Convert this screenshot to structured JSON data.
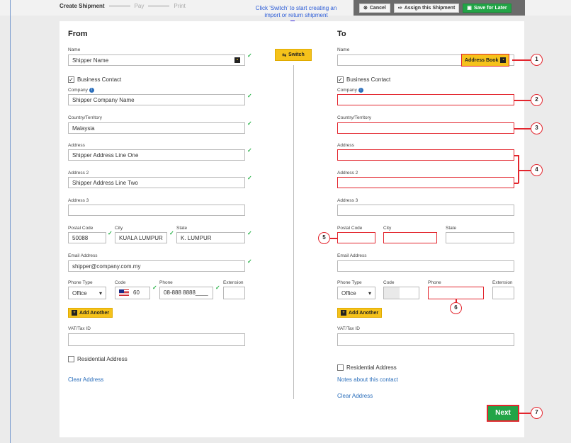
{
  "steps": {
    "create": "Create Shipment",
    "pay": "Pay",
    "print": "Print"
  },
  "hint": "Click 'Switch' to start creating an import or return shipment",
  "actions": {
    "cancel": "Cancel",
    "assign": "Assign this Shipment",
    "save": "Save for Later"
  },
  "switch_label": "Switch",
  "from": {
    "heading": "From",
    "name_label": "Name",
    "name_value": "Shipper Name",
    "business_contact": "Business Contact",
    "company_label": "Company",
    "company_value": "Shipper Company Name",
    "country_label": "Country/Territory",
    "country_value": "Malaysia",
    "address_label": "Address",
    "address_value": "Shipper Address Line One",
    "address2_label": "Address 2",
    "address2_value": "Shipper Address Line Two",
    "address3_label": "Address 3",
    "postal_label": "Postal Code",
    "postal_value": "50088",
    "city_label": "City",
    "city_value": "KUALA LUMPUR",
    "state_label": "State",
    "state_value": "K. LUMPUR",
    "email_label": "Email Address",
    "email_value": "shipper@company.com.my",
    "phone_type_label": "Phone Type",
    "phone_type_value": "Office",
    "code_label": "Code",
    "code_value": "60",
    "phone_label": "Phone",
    "phone_value": "08-888 8888____",
    "extension_label": "Extension",
    "add_another": "Add Another",
    "vat_label": "VAT/Tax ID",
    "residential": "Residential Address",
    "clear": "Clear Address"
  },
  "to": {
    "heading": "To",
    "name_label": "Name",
    "address_book": "Address Book",
    "business_contact": "Business Contact",
    "company_label": "Company",
    "country_label": "Country/Territory",
    "address_label": "Address",
    "address2_label": "Address 2",
    "address3_label": "Address 3",
    "postal_label": "Postal Code",
    "city_label": "City",
    "state_label": "State",
    "email_label": "Email Address",
    "phone_type_label": "Phone Type",
    "phone_type_value": "Office",
    "code_label": "Code",
    "phone_label": "Phone",
    "extension_label": "Extension",
    "add_another": "Add Another",
    "vat_label": "VAT/Tax ID",
    "residential": "Residential Address",
    "notes": "Notes about this contact",
    "clear": "Clear Address"
  },
  "next": "Next",
  "callouts": [
    "1",
    "2",
    "3",
    "4",
    "5",
    "6",
    "7"
  ],
  "colors": {
    "accent_yellow": "#f5c21b",
    "green": "#22a447",
    "callout_red": "#e3262e",
    "hint_blue": "#2a5bd7"
  }
}
